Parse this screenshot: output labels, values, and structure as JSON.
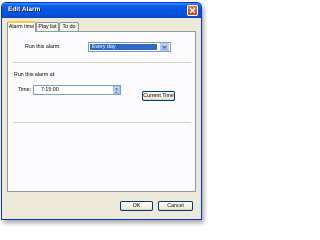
{
  "window": {
    "title": "Edit Alarm"
  },
  "tabs": [
    {
      "label": "Alarm time",
      "active": true
    },
    {
      "label": "Play list",
      "active": false
    },
    {
      "label": "To do",
      "active": false
    }
  ],
  "alarm_time": {
    "run_label": "Run this alarm:",
    "run_value": "Every day",
    "run_at_label": "Run this alarm at:",
    "time_label": "Time:",
    "time_value": "7:15:00",
    "current_time_button": "Current Time"
  },
  "footer": {
    "ok_label": "OK",
    "cancel_label": "Cancel"
  },
  "colors": {
    "titlebar": "#0554e3",
    "selection": "#316ac5",
    "dialog_bg": "#ece9d8"
  },
  "icons": {
    "close": "close-icon",
    "dropdown": "chevron-down-icon",
    "spin_up": "arrow-up-icon",
    "spin_down": "arrow-down-icon"
  }
}
